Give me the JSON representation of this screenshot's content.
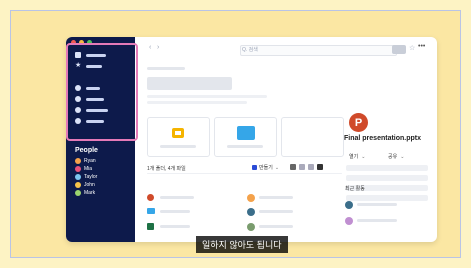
{
  "sidebar": {
    "people_title": "People",
    "people": [
      {
        "name": "Ryan",
        "color": "#f4a24b"
      },
      {
        "name": "Mia",
        "color": "#e8507a"
      },
      {
        "name": "Taylor",
        "color": "#7cc6f0"
      },
      {
        "name": "John",
        "color": "#f6c34a"
      },
      {
        "name": "Mark",
        "color": "#9bd46e"
      }
    ]
  },
  "toolbar": {
    "search_placeholder": "Q. 검색",
    "back_icon": "‹",
    "forward_icon": "›"
  },
  "main": {
    "count_text": "1개 폴더, 4개 파일",
    "new_button_label": "만들기"
  },
  "details": {
    "file_name": "Final presentation.pptx",
    "open_label": "열기",
    "share_label": "공유",
    "activity_title": "최근 활동"
  },
  "caption": "일하지 않아도 됩니다",
  "colors": {
    "sidebar_bg": "#0d1a4b",
    "highlight": "#e47ab8",
    "ppt_brand": "#d04a2a",
    "folder": "#35a6e8",
    "slides": "#f5b400"
  }
}
